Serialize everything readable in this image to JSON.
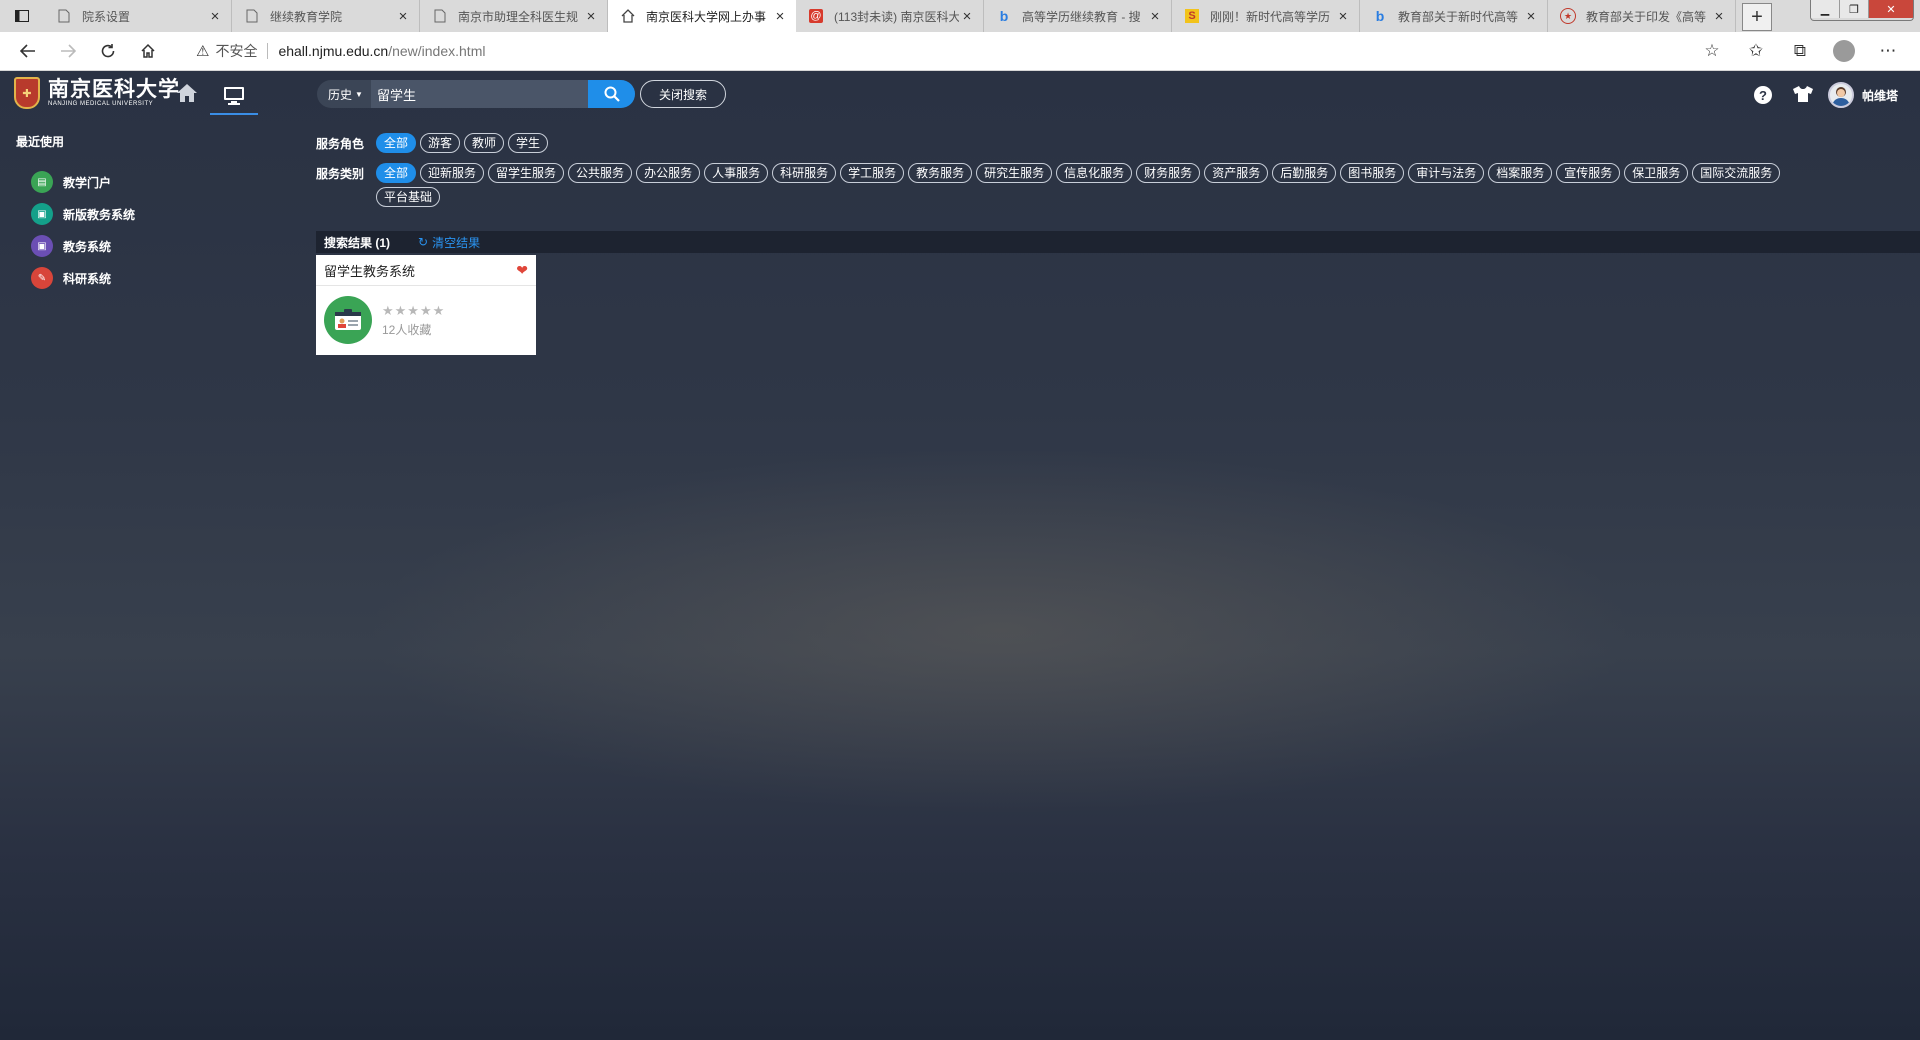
{
  "browser": {
    "tabs": [
      {
        "title": "院系设置",
        "icon": "page-icon",
        "active": false
      },
      {
        "title": "继续教育学院",
        "icon": "page-icon",
        "active": false
      },
      {
        "title": "南京市助理全科医生规",
        "icon": "page-icon",
        "active": false
      },
      {
        "title": "南京医科大学网上办事",
        "icon": "home-icon",
        "active": true
      },
      {
        "title": "(113封未读) 南京医科大",
        "icon": "mail-icon",
        "active": false
      },
      {
        "title": "高等学历继续教育 - 搜",
        "icon": "bing-icon",
        "active": false
      },
      {
        "title": "刚刚！新时代高等学历",
        "icon": "sohu-icon",
        "active": false
      },
      {
        "title": "教育部关于新时代高等",
        "icon": "bing-icon",
        "active": false
      },
      {
        "title": "教育部关于印发《高等",
        "icon": "gov-icon",
        "active": false
      }
    ],
    "address": {
      "security_label": "不安全",
      "host": "ehall.njmu.edu.cn",
      "path": "/new/index.html"
    }
  },
  "header": {
    "logo_cn": "南京医科大学",
    "logo_en": "NANJING MEDICAL UNIVERSITY",
    "search": {
      "history_label": "历史",
      "value": "留学生",
      "close_label": "关闭搜索"
    },
    "username": "帕维塔"
  },
  "sidebar": {
    "title": "最近使用",
    "items": [
      {
        "label": "教学门户",
        "color": "#3aa455"
      },
      {
        "label": "新版教务系统",
        "color": "#14a08a"
      },
      {
        "label": "教务系统",
        "color": "#6b4fb4"
      },
      {
        "label": "科研系统",
        "color": "#d8453a"
      }
    ]
  },
  "filters": {
    "role": {
      "label": "服务角色",
      "options": [
        "全部",
        "游客",
        "教师",
        "学生"
      ],
      "selected": "全部"
    },
    "category": {
      "label": "服务类别",
      "options": [
        "全部",
        "迎新服务",
        "留学生服务",
        "公共服务",
        "办公服务",
        "人事服务",
        "科研服务",
        "学工服务",
        "教务服务",
        "研究生服务",
        "信息化服务",
        "财务服务",
        "资产服务",
        "后勤服务",
        "图书服务",
        "审计与法务",
        "档案服务",
        "宣传服务",
        "保卫服务",
        "国际交流服务",
        "平台基础"
      ],
      "selected": "全部"
    }
  },
  "results": {
    "title": "搜索结果 (1)",
    "clear_label": "清空结果",
    "items": [
      {
        "name": "留学生教务系统",
        "stars": "★★★★★",
        "favorites": "12人收藏"
      }
    ]
  },
  "colors": {
    "accent": "#1f8ee9",
    "heart": "#e0463a",
    "app_icon_bg": "#3aa455"
  }
}
